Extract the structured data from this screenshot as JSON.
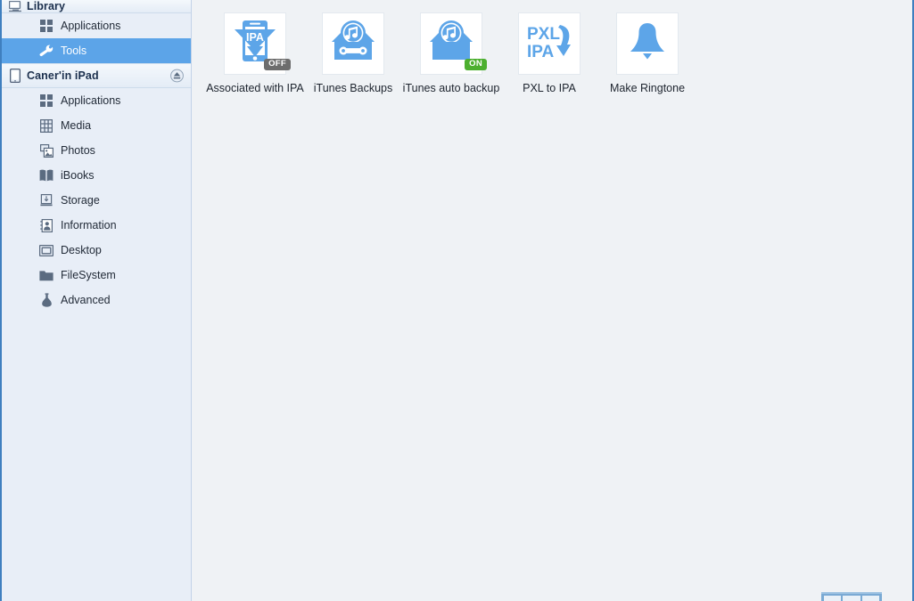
{
  "sidebar": {
    "library": {
      "label": "Library",
      "icon": "monitor-icon",
      "items": [
        {
          "label": "Applications",
          "icon": "grid-apps-icon",
          "selected": false
        },
        {
          "label": "Tools",
          "icon": "wrench-icon",
          "selected": true
        }
      ]
    },
    "device": {
      "label": "Caner'in iPad",
      "icon": "ipad-icon",
      "eject_icon": "eject-icon",
      "items": [
        {
          "label": "Applications",
          "icon": "grid-apps-icon"
        },
        {
          "label": "Media",
          "icon": "film-icon"
        },
        {
          "label": "Photos",
          "icon": "photo-icon"
        },
        {
          "label": "iBooks",
          "icon": "book-icon"
        },
        {
          "label": "Storage",
          "icon": "usb-drive-icon"
        },
        {
          "label": "Information",
          "icon": "contact-card-icon"
        },
        {
          "label": "Desktop",
          "icon": "display-icon"
        },
        {
          "label": "FileSystem",
          "icon": "folder-icon"
        },
        {
          "label": "Advanced",
          "icon": "flask-icon"
        }
      ]
    }
  },
  "tools": [
    {
      "label": "Associated with IPA",
      "icon": "ipa-download-phone-icon",
      "badge": "OFF",
      "badge_state": "off"
    },
    {
      "label": "iTunes Backups",
      "icon": "itunes-backup-wrench-icon",
      "badge": null,
      "badge_state": null
    },
    {
      "label": "iTunes auto backup",
      "icon": "itunes-auto-backup-icon",
      "badge": "ON",
      "badge_state": "on"
    },
    {
      "label": "PXL to IPA",
      "icon": "pxl-to-ipa-icon",
      "badge": null,
      "badge_state": null
    },
    {
      "label": "Make Ringtone",
      "icon": "bell-icon",
      "badge": null,
      "badge_state": null
    }
  ],
  "colors": {
    "accent_blue": "#5ca4e8",
    "icon_blue": "#5da5e8",
    "sidebar_bg": "#e8eef7",
    "content_bg": "#eff2f5",
    "window_border": "#3f7fbf",
    "badge_off": "#6d6d6d",
    "badge_on": "#4caf2f",
    "text_dark": "#1d242e"
  }
}
